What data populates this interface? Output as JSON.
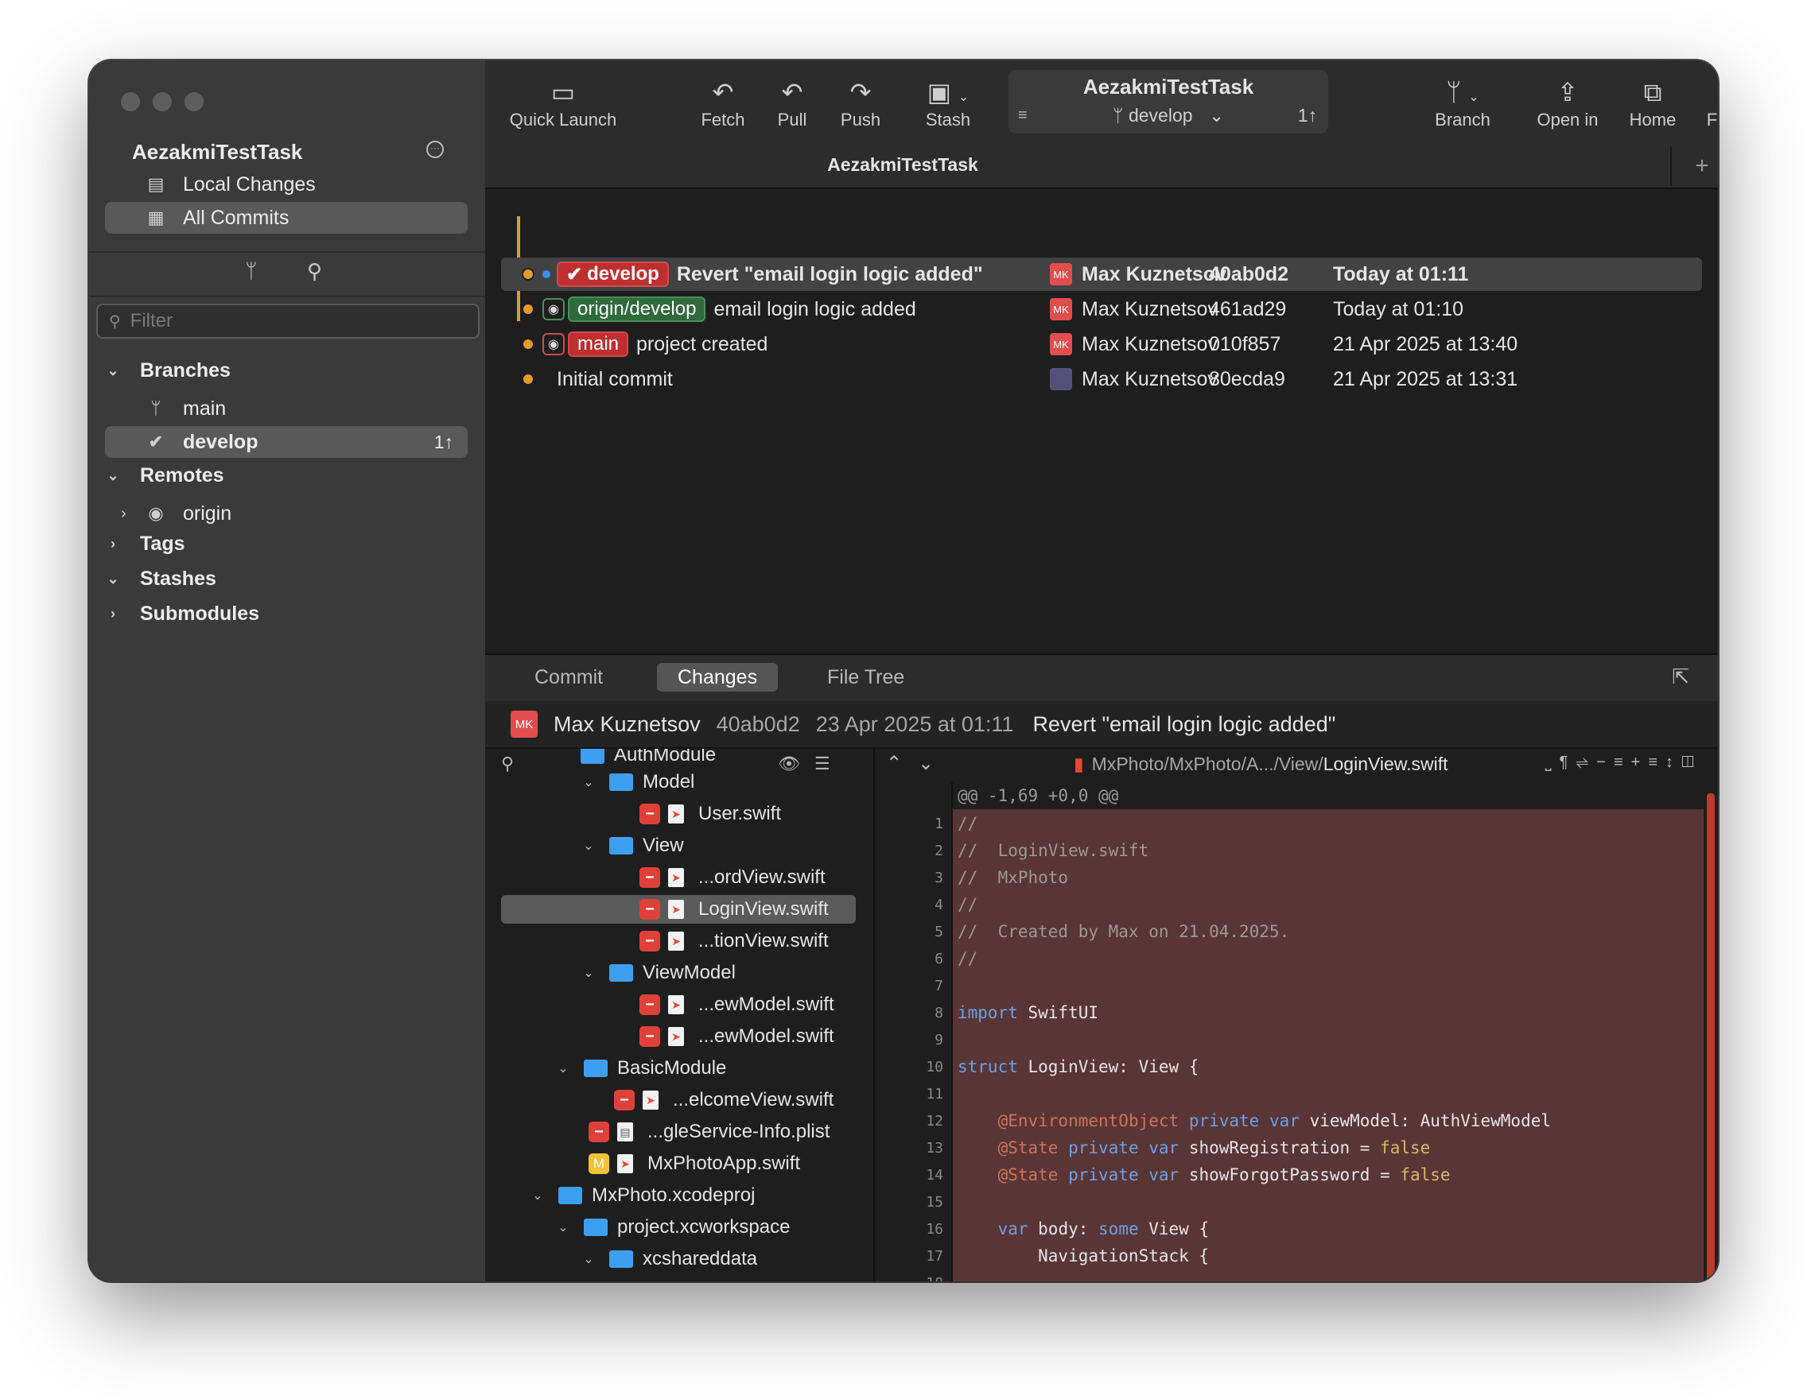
{
  "window": {
    "repo_name": "AezakmiTestTask",
    "tab_title": "AezakmiTestTask"
  },
  "sidebar": {
    "repo_title": "AezakmiTestTask",
    "nav": [
      {
        "label": "Local Changes",
        "icon": "local-changes-icon"
      },
      {
        "label": "All Commits",
        "icon": "all-commits-icon"
      }
    ],
    "filter_placeholder": "Filter",
    "sections": {
      "branches": "Branches",
      "remotes": "Remotes",
      "tags": "Tags",
      "stashes": "Stashes",
      "submodules": "Submodules"
    },
    "branches": [
      {
        "name": "main",
        "ahead": ""
      },
      {
        "name": "develop",
        "ahead": "1↑"
      }
    ],
    "remotes": [
      {
        "name": "origin"
      }
    ]
  },
  "toolbar": {
    "quick_launch": "Quick Launch",
    "fetch": "Fetch",
    "pull": "Pull",
    "push": "Push",
    "stash": "Stash",
    "center_repo": "AezakmiTestTask",
    "center_branch": "develop",
    "center_ahead": "1↑",
    "branch": "Branch",
    "open_in": "Open in",
    "home": "Home",
    "feedback": "Feedback"
  },
  "commits": [
    {
      "tag": "develop",
      "message": "Revert \"email login logic added\"",
      "author": "Max Kuznetsov",
      "sha": "40ab0d2",
      "date": "Today at 01:11"
    },
    {
      "tag": "origin/develop",
      "message": "email login logic added",
      "author": "Max Kuznetsov",
      "sha": "461ad29",
      "date": "Today at 01:10"
    },
    {
      "tag": "main",
      "message": "project created",
      "author": "Max Kuznetsov",
      "sha": "010f857",
      "date": "21 Apr 2025 at 13:40"
    },
    {
      "tag": "",
      "message": "Initial commit",
      "author": "Max Kuznetsov",
      "sha": "80ecda9",
      "date": "21 Apr 2025 at 13:31"
    }
  ],
  "avatar_initials": "MK",
  "detail": {
    "tabs": [
      "Commit",
      "Changes",
      "File Tree"
    ],
    "active_tab": "Changes",
    "author": "Max Kuznetsov",
    "sha": "40ab0d2",
    "date": "23 Apr 2025 at 01:11",
    "message": "Revert \"email login logic added\""
  },
  "tree": [
    {
      "label": "AuthModule",
      "kind": "folder"
    },
    {
      "label": "Model",
      "kind": "folder"
    },
    {
      "label": "User.swift",
      "kind": "removed"
    },
    {
      "label": "View",
      "kind": "folder"
    },
    {
      "label": "...ordView.swift",
      "kind": "removed"
    },
    {
      "label": "LoginView.swift",
      "kind": "removed",
      "selected": true
    },
    {
      "label": "...tionView.swift",
      "kind": "removed"
    },
    {
      "label": "ViewModel",
      "kind": "folder"
    },
    {
      "label": "...ewModel.swift",
      "kind": "removed"
    },
    {
      "label": "...ewModel.swift",
      "kind": "removed"
    },
    {
      "label": "BasicModule",
      "kind": "folder"
    },
    {
      "label": "...elcomeView.swift",
      "kind": "removed"
    },
    {
      "label": "...gleService-Info.plist",
      "kind": "removed"
    },
    {
      "label": "MxPhotoApp.swift",
      "kind": "modified"
    },
    {
      "label": "MxPhoto.xcodeproj",
      "kind": "folder"
    },
    {
      "label": "project.xcworkspace",
      "kind": "folder"
    },
    {
      "label": "xcshareddata",
      "kind": "folder"
    }
  ],
  "modified_badge": "M",
  "diff": {
    "path_prefix": "MxPhoto/MxPhoto/A.../View/",
    "path_file": "LoginView.swift",
    "hunk": "@@ -1,69 +0,0 @@",
    "lines": [
      "//",
      "//  LoginView.swift",
      "//  MxPhoto",
      "//",
      "//  Created by Max on 21.04.2025.",
      "//",
      "",
      "import SwiftUI",
      "",
      "struct LoginView: View {",
      "",
      "    @EnvironmentObject private var viewModel: AuthViewModel",
      "    @State private var showRegistration = false",
      "    @State private var showForgotPassword = false",
      "",
      "    var body: some View {",
      "        NavigationStack {",
      ""
    ]
  }
}
